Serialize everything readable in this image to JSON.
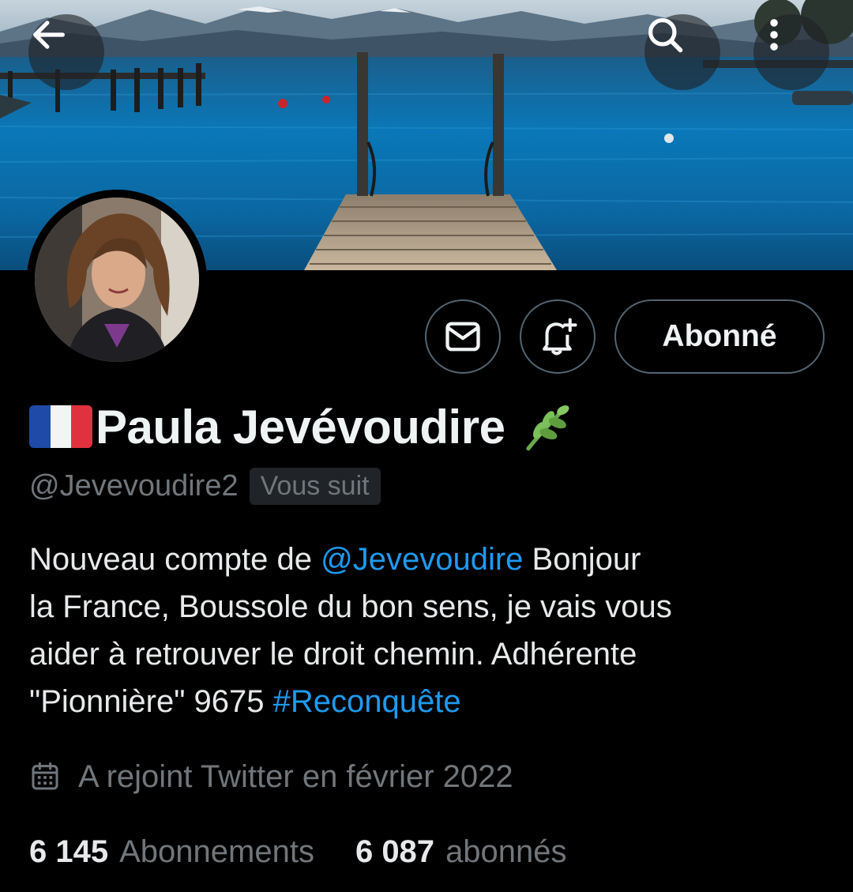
{
  "header": {
    "back_icon": "arrow-left-icon",
    "search_icon": "search-icon",
    "more_icon": "more-vertical-icon"
  },
  "profile": {
    "flag_emoji": "🇫🇷",
    "display_name": "Paula Jevévoudire",
    "name_emoji": "🌿",
    "handle": "@Jevevoudire2",
    "follows_you_badge": "Vous suit",
    "bio": {
      "l1_a": "Nouveau compte de ",
      "l1_mention": "@Jevevoudire",
      "l1_b": " Bonjour",
      "l2": "la France, Boussole du bon sens, je vais vous",
      "l3": "aider à retrouver le droit chemin. Adhérente",
      "l4_a": "\"Pionnière\" 9675 ",
      "l4_hashtag": "#Reconquête"
    },
    "joined": "A rejoint Twitter en février 2022",
    "following_count": "6 145",
    "following_label": "Abonnements",
    "followers_count": "6 087",
    "followers_label": "abonnés"
  },
  "actions": {
    "message_icon": "mail-icon",
    "notify_icon": "bell-plus-icon",
    "follow_label": "Abonné"
  },
  "colors": {
    "background": "#000000",
    "text_primary": "#e7e9ea",
    "text_secondary": "#71767b",
    "link": "#1d9bf0",
    "button_border": "#536471",
    "badge_bg": "#202327"
  }
}
